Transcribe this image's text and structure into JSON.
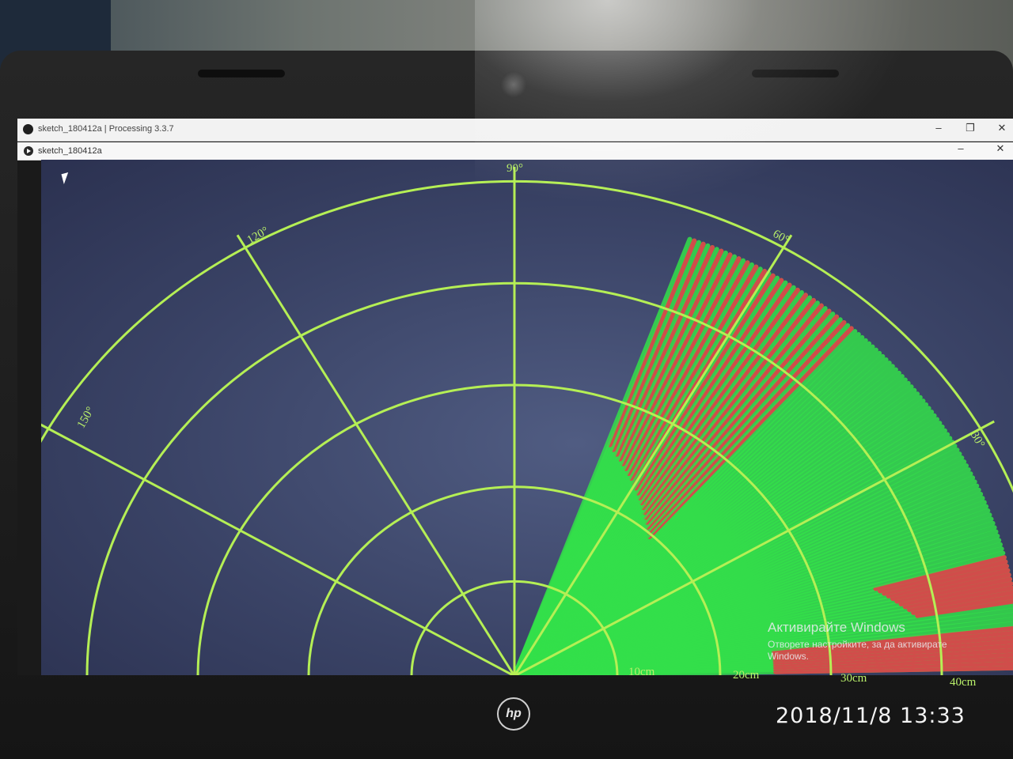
{
  "window": {
    "title": "sketch_180412a | Processing 3.3.7",
    "sketch_title": "sketch_180412a",
    "controls": [
      "–",
      "❐",
      "✕"
    ]
  },
  "radar": {
    "angle_labels": [
      "150°",
      "120°",
      "90°",
      "60°",
      "30°"
    ],
    "distance_labels": [
      "10cm",
      "20cm",
      "30cm",
      "40cm"
    ],
    "colors": {
      "grid": "#b5ef55",
      "sweep": "#33e04a",
      "object": "#d9474a",
      "background": "#3c4568"
    }
  },
  "watermark": {
    "heading": "Активирайте Windows",
    "subtext": "Отворете настройките, за да активирате Windows."
  },
  "laptop": {
    "brand_logo": "hp"
  },
  "photo_stamp": "2018/11/8  13:33"
}
